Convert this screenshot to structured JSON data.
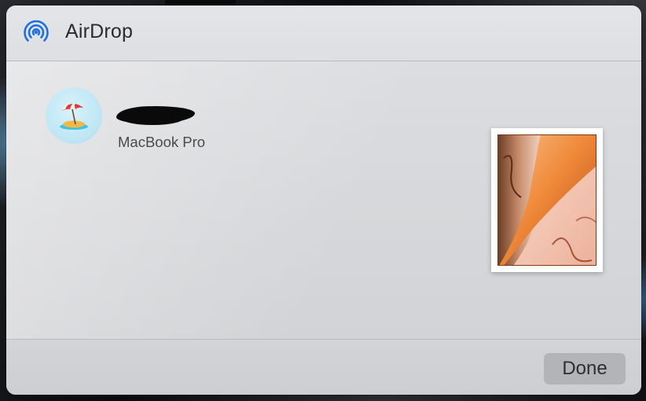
{
  "window": {
    "title": "AirDrop",
    "icon": "airdrop-icon"
  },
  "device": {
    "name": "",
    "name_redacted": true,
    "type": "MacBook Pro",
    "avatar_icon": "beach-umbrella-island-emoji"
  },
  "attachment": {
    "kind": "image-thumbnail"
  },
  "footer": {
    "done_label": "Done"
  },
  "colors": {
    "accent": "#1f6fe0",
    "sheet_background": "#d9dadd",
    "button_background": "#b3b4b7"
  }
}
